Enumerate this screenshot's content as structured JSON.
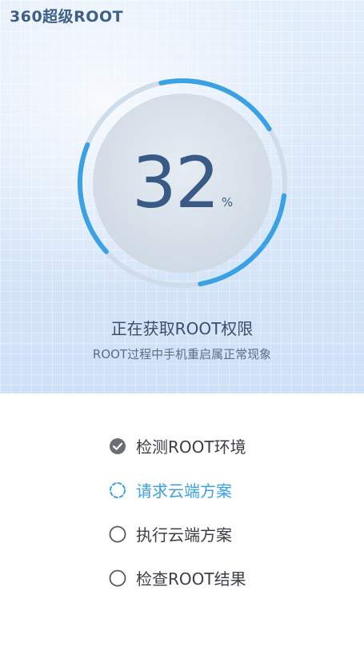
{
  "app": {
    "title": "360超级ROOT"
  },
  "progress": {
    "value": 32,
    "unit": "%"
  },
  "status": {
    "title": "正在获取ROOT权限",
    "subtitle": "ROOT过程中手机重启属正常现象"
  },
  "steps": [
    {
      "label": "检测ROOT环境",
      "state": "done",
      "icon": "check-circle-icon"
    },
    {
      "label": "请求云端方案",
      "state": "in-progress",
      "icon": "spinner-icon"
    },
    {
      "label": "执行云端方案",
      "state": "pending",
      "icon": "empty-circle-icon"
    },
    {
      "label": "检查ROOT结果",
      "state": "pending",
      "icon": "empty-circle-icon"
    }
  ],
  "colors": {
    "accent": "#3aa2e4",
    "ring_track": "#cfdcea",
    "hero_bg": "#d9e7f8",
    "text_primary": "#3b4f66",
    "done_icon": "#6a6f75"
  }
}
